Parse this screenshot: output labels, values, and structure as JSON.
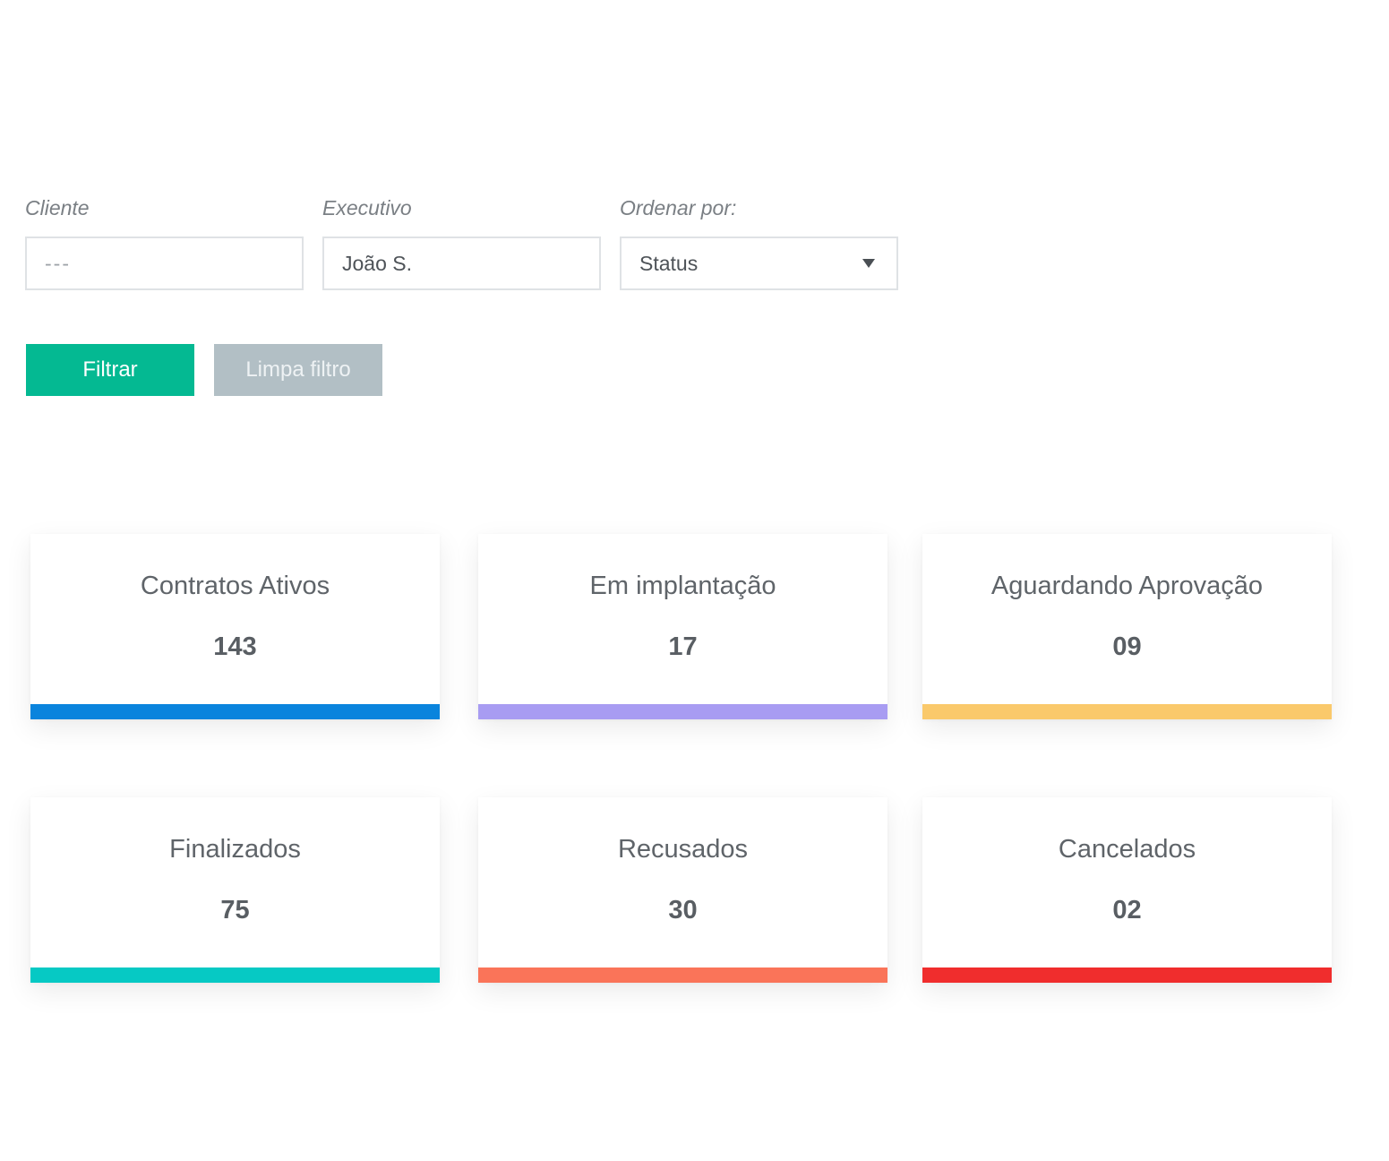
{
  "filters": {
    "cliente": {
      "label": "Cliente",
      "placeholder": "---",
      "value": ""
    },
    "executivo": {
      "label": "Executivo",
      "value": "João S."
    },
    "ordenar": {
      "label": "Ordenar por:",
      "selected": "Status"
    }
  },
  "actions": {
    "filter_label": "Filtrar",
    "clear_label": "Limpa filtro"
  },
  "colors": {
    "primary_button": "#04b992",
    "secondary_button": "#b2bfc5"
  },
  "stats": [
    {
      "title": "Contratos Ativos",
      "value": "143",
      "color": "#0a84dd"
    },
    {
      "title": "Em implantação",
      "value": "17",
      "color": "#a89cf2"
    },
    {
      "title": "Aguardando Aprovação",
      "value": "09",
      "color": "#fac96b"
    },
    {
      "title": "Finalizados",
      "value": "75",
      "color": "#06c9c4"
    },
    {
      "title": "Recusados",
      "value": "30",
      "color": "#fa7459"
    },
    {
      "title": "Cancelados",
      "value": "02",
      "color": "#f02d2d"
    }
  ]
}
